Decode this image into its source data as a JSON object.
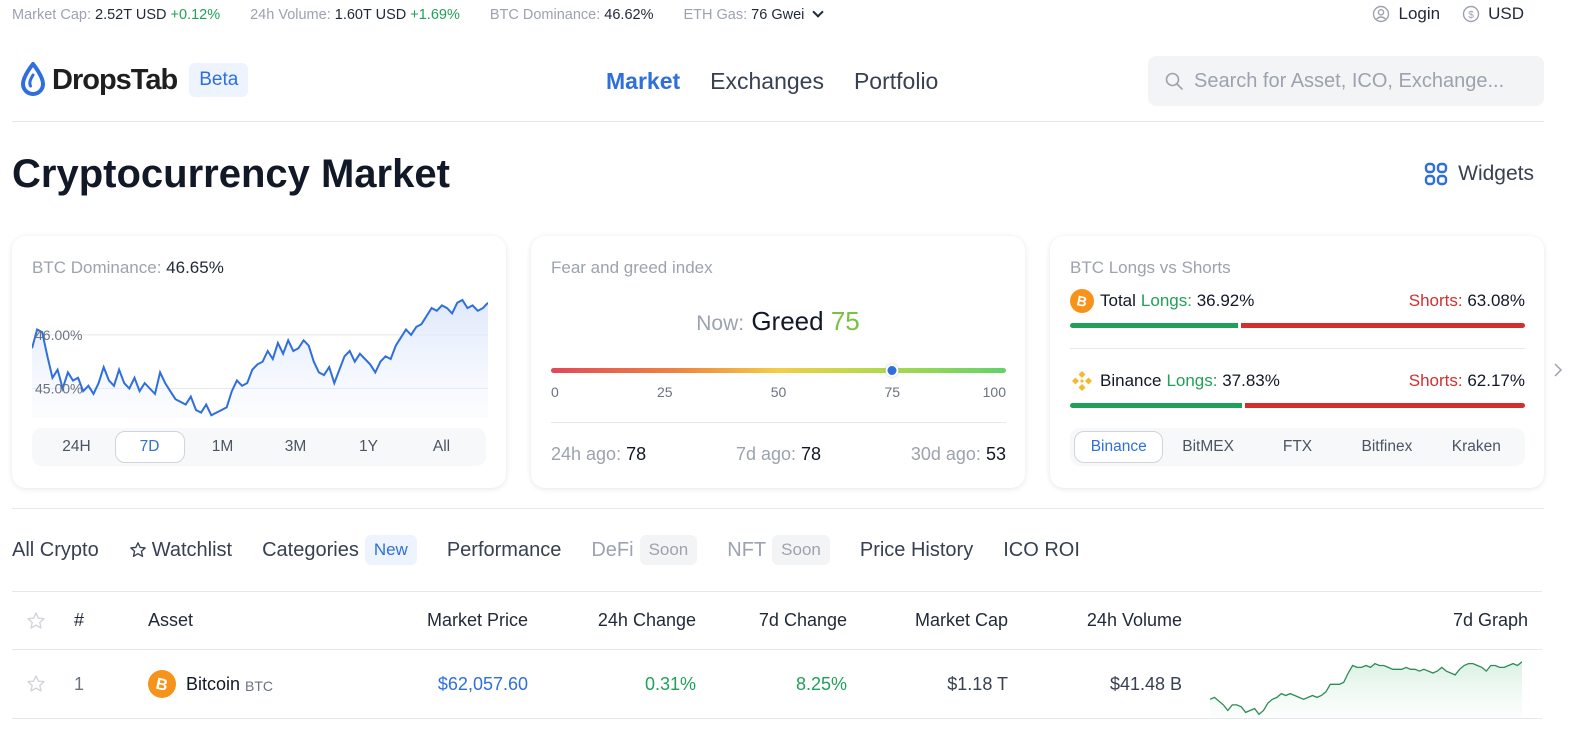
{
  "ticker": {
    "market_cap_label": "Market Cap:",
    "market_cap_value": "2.52T USD",
    "market_cap_change": "+0.12%",
    "volume_label": "24h Volume:",
    "volume_value": "1.60T USD",
    "volume_change": "+1.69%",
    "dominance_label": "BTC Dominance:",
    "dominance_value": "46.62%",
    "gas_label": "ETH Gas:",
    "gas_value": "76 Gwei"
  },
  "top_right": {
    "login_label": "Login",
    "currency_label": "USD"
  },
  "header": {
    "logo_text": "DropsTab",
    "beta_badge": "Beta",
    "nav": [
      {
        "label": "Market",
        "active": true
      },
      {
        "label": "Exchanges",
        "active": false
      },
      {
        "label": "Portfolio",
        "active": false
      }
    ],
    "search_placeholder": "Search for Asset, ICO, Exchange..."
  },
  "page": {
    "title": "Cryptocurrency Market",
    "widgets_label": "Widgets"
  },
  "dominance_card": {
    "title_label": "BTC Dominance:",
    "title_value": "46.65%",
    "y_labels": [
      "46.00%",
      "45.00%"
    ],
    "ranges": [
      "24H",
      "7D",
      "1M",
      "3M",
      "1Y",
      "All"
    ],
    "active_range": "7D",
    "series": [
      45.75,
      46.1,
      46.05,
      45.6,
      45.2,
      45.35,
      45.0,
      45.3,
      45.15,
      45.2,
      44.95,
      45.05,
      44.9,
      45.1,
      45.4,
      45.15,
      45.05,
      45.35,
      45.1,
      45.0,
      45.2,
      44.95,
      45.1,
      45.0,
      44.9,
      45.3,
      45.1,
      44.95,
      44.8,
      44.75,
      44.7,
      44.85,
      44.6,
      44.55,
      44.7,
      44.5,
      44.55,
      44.6,
      44.65,
      44.95,
      45.15,
      45.05,
      45.1,
      45.35,
      45.45,
      45.5,
      45.7,
      45.55,
      45.85,
      45.65,
      45.9,
      45.7,
      45.75,
      45.9,
      45.8,
      45.5,
      45.3,
      45.25,
      45.4,
      45.1,
      45.35,
      45.6,
      45.7,
      45.5,
      45.65,
      45.55,
      45.45,
      45.3,
      45.5,
      45.6,
      45.55,
      45.8,
      45.95,
      46.1,
      46.0,
      46.15,
      46.2,
      46.35,
      46.5,
      46.45,
      46.55,
      46.5,
      46.4,
      46.6,
      46.65,
      46.5,
      46.55,
      46.45,
      46.5,
      46.6
    ]
  },
  "fear_greed_card": {
    "title": "Fear and greed index",
    "now_label": "Now:",
    "now_status": "Greed",
    "now_value": 75,
    "scale_ticks": [
      "0",
      "25",
      "50",
      "75",
      "100"
    ],
    "history": [
      {
        "label": "24h ago:",
        "value": "78"
      },
      {
        "label": "7d ago:",
        "value": "78"
      },
      {
        "label": "30d ago:",
        "value": "53"
      }
    ]
  },
  "longs_shorts_card": {
    "title": "BTC Longs vs Shorts",
    "rows": [
      {
        "name": "Total",
        "longs_label": "Longs:",
        "longs": "36.92%",
        "longs_pct": 36.92,
        "shorts_label": "Shorts:",
        "shorts": "63.08%",
        "icon": "bitcoin-icon"
      },
      {
        "name": "Binance",
        "longs_label": "Longs:",
        "longs": "37.83%",
        "longs_pct": 37.83,
        "shorts_label": "Shorts:",
        "shorts": "62.17%",
        "icon": "binance-icon"
      }
    ],
    "exchanges": [
      "Binance",
      "BitMEX",
      "FTX",
      "Bitfinex",
      "Kraken"
    ],
    "active_exchange": "Binance"
  },
  "tabs": [
    {
      "label": "All Crypto",
      "badge": null,
      "disabled": false
    },
    {
      "label": "Watchlist",
      "badge": null,
      "disabled": false,
      "icon": "star-icon"
    },
    {
      "label": "Categories",
      "badge": "New",
      "disabled": false
    },
    {
      "label": "Performance",
      "badge": null,
      "disabled": false
    },
    {
      "label": "DeFi",
      "badge": "Soon",
      "disabled": true
    },
    {
      "label": "NFT",
      "badge": "Soon",
      "disabled": true
    },
    {
      "label": "Price History",
      "badge": null,
      "disabled": false
    },
    {
      "label": "ICO ROI",
      "badge": null,
      "disabled": false
    }
  ],
  "table": {
    "headers": {
      "num": "#",
      "asset": "Asset",
      "price": "Market Price",
      "change_24h": "24h Change",
      "change_7d": "7d Change",
      "market_cap": "Market Cap",
      "volume_24h": "24h Volume",
      "graph": "7d Graph"
    },
    "rows": [
      {
        "rank": "1",
        "name": "Bitcoin",
        "symbol": "BTC",
        "price": "$62,057.60",
        "change_24h": "0.31%",
        "change_7d": "8.25%",
        "market_cap": "$1.18 T",
        "volume_24h": "$41.48 B",
        "sparkline": [
          30,
          31,
          29,
          27,
          24,
          27,
          27,
          26,
          23,
          24,
          25,
          22,
          24,
          28,
          30,
          31,
          33,
          32,
          33,
          32,
          31,
          30,
          31,
          32,
          31,
          32,
          34,
          38,
          38,
          38,
          39,
          44,
          48,
          47,
          47,
          48,
          47,
          49,
          48,
          48,
          47,
          46,
          46,
          46,
          47,
          46,
          46,
          45,
          46,
          45,
          44,
          45,
          47,
          45,
          44,
          43,
          46,
          48,
          49,
          49,
          48,
          47,
          45,
          48,
          48,
          47,
          47,
          48,
          49,
          48,
          50
        ]
      }
    ]
  },
  "colors": {
    "accent": "#2f6fdb",
    "positive": "#21a05a",
    "negative": "#d32f2f",
    "greed": "#7cc242",
    "bitcoin": "#f7931a",
    "binance": "#f3ba2f"
  }
}
